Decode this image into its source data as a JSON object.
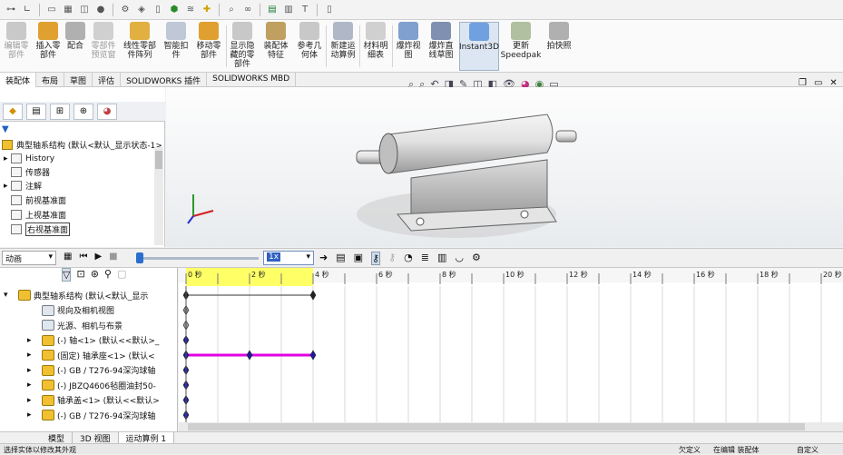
{
  "ribbon": {
    "buttons": [
      {
        "label": "编辑零\n部件",
        "dim": true,
        "color": "#c9c9c9"
      },
      {
        "label": "插入零\n部件",
        "dim": false,
        "color": "#e0a030"
      },
      {
        "label": "配合",
        "dim": false,
        "color": "#b0b0b0"
      },
      {
        "label": "零部件\n预览窗",
        "dim": true,
        "color": "#d0d0d0"
      },
      {
        "label": "线性零部\n件阵列",
        "dim": false,
        "color": "#e2b040"
      },
      {
        "label": "智能扣\n件",
        "dim": false,
        "color": "#c0c8d8"
      },
      {
        "label": "移动零\n部件",
        "dim": false,
        "color": "#e0a030"
      },
      {
        "label": "显示隐\n藏的零\n部件",
        "dim": false,
        "color": "#c8c8c8"
      },
      {
        "label": "装配体\n特征",
        "dim": false,
        "color": "#c0a060"
      },
      {
        "label": "参考几\n何体",
        "dim": false,
        "color": "#c8c8c8"
      },
      {
        "label": "新建运\n动算例",
        "dim": false,
        "color": "#b0b8c8"
      },
      {
        "label": "材料明\n细表",
        "dim": false,
        "color": "#d0d0d0"
      },
      {
        "label": "爆炸视\n图",
        "dim": false,
        "color": "#80a0d0"
      },
      {
        "label": "爆炸直\n线草图",
        "dim": false,
        "color": "#8090b0"
      },
      {
        "label": "Instant3D",
        "dim": false,
        "color": "#70a0e0"
      },
      {
        "label": "更新\nSpeedpak",
        "dim": false,
        "color": "#b0c0a0"
      },
      {
        "label": "拍快照",
        "dim": false,
        "color": "#b0b0b0"
      }
    ]
  },
  "tabs": [
    "装配体",
    "布局",
    "草图",
    "评估",
    "SOLIDWORKS 插件",
    "SOLIDWORKS MBD"
  ],
  "tree": {
    "root": "典型轴系结构 (默认<默认_显示状态-1>",
    "items": [
      "History",
      "传感器",
      "注解",
      "前视基准面",
      "上视基准面",
      "右视基准面"
    ]
  },
  "motion": {
    "study_type": "动画",
    "speed": "1x",
    "ruler": [
      "0 秒",
      "2 秒",
      "4 秒",
      "6 秒",
      "8 秒",
      "10 秒",
      "12 秒",
      "14 秒",
      "16 秒",
      "18 秒",
      "20 秒"
    ],
    "rows": [
      "典型轴系结构 (默认<默认_显示",
      "视向及相机视图",
      "光源、相机与布景",
      "(-) 轴<1> (默认<<默认>_",
      "(固定) 轴承座<1> (默认<",
      "(-) GB / T276-94深沟球轴",
      "(-) JBZQ4606毡圈油封50-",
      "轴承盖<1> (默认<<默认>",
      "(-) GB / T276-94深沟球轴"
    ]
  },
  "bottom_tabs": [
    "模型",
    "3D 视图",
    "运动算例 1"
  ],
  "status": {
    "left": "选择实体以修改其外观",
    "under_defined": "欠定义",
    "editing": "在编辑 装配体",
    "custom": "自定义"
  },
  "colors": {
    "accent": "#e000e0",
    "timeline_highlight": "#ffff66",
    "diamond": "#1a1aa0"
  }
}
